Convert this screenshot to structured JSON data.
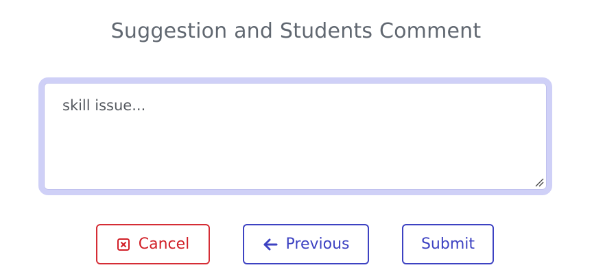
{
  "form": {
    "title": "Suggestion and Students Comment",
    "comment_value": "skill issue..."
  },
  "actions": {
    "cancel_label": "Cancel",
    "previous_label": "Previous",
    "submit_label": "Submit"
  },
  "icons": {
    "cancel": "close-box-icon",
    "previous": "arrow-left-icon",
    "resize": "resize-grip-icon"
  },
  "colors": {
    "title_text": "#606770",
    "comment_border": "#cfd0f7",
    "cancel": "#d11f27",
    "primary": "#3d42c2"
  }
}
